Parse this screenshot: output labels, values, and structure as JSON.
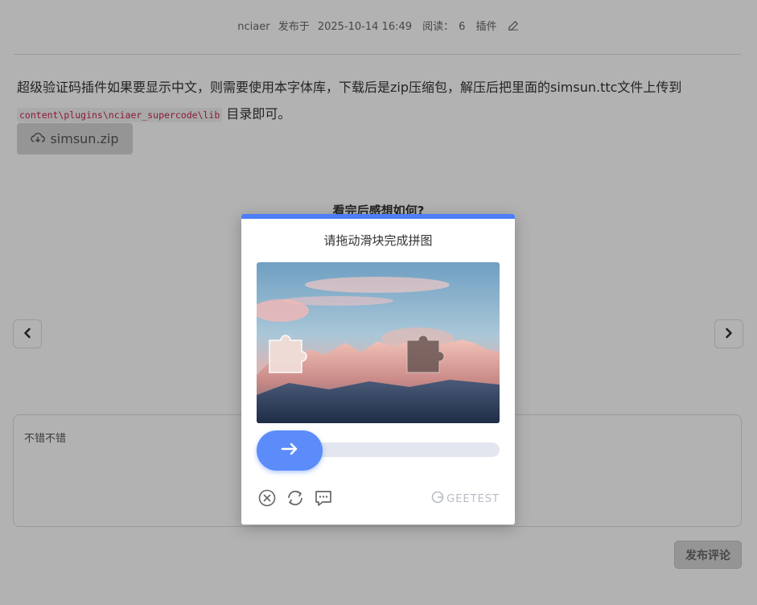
{
  "meta": {
    "author": "nciaer",
    "published_prefix": "发布于",
    "datetime": "2025-10-14 16:49",
    "reads_label": "阅读：",
    "reads_count": "6",
    "category": "插件"
  },
  "article": {
    "paragraph_text": "超级验证码插件如果要显示中文，则需要使用本字体库，下载后是zip压缩包，解压后把里面的simsun.ttc文件上传到",
    "code_path": "content\\plugins\\nciaer_supercode\\lib",
    "paragraph_suffix": "目录即可。",
    "download_label": "simsun.zip"
  },
  "feedback": {
    "question": "看完后感想如何?"
  },
  "comment": {
    "text": "不错不错",
    "submit_label": "发布评论"
  },
  "captcha": {
    "title": "请拖动滑块完成拼图",
    "brand": "GEETEST",
    "accent_color": "#4d7ef7",
    "slider_progress": 0
  },
  "icons": {
    "edit": "edit-icon",
    "download": "cloud-download-icon",
    "prev": "chevron-left-icon",
    "next": "chevron-right-icon",
    "close": "close-circle-icon",
    "refresh": "refresh-icon",
    "feedback": "feedback-icon",
    "arrow": "arrow-right-icon"
  }
}
